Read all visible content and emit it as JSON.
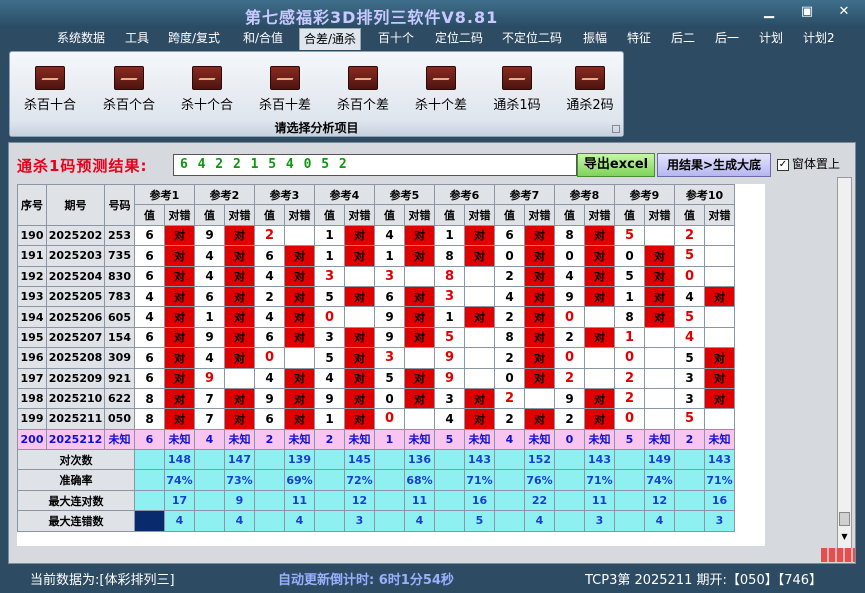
{
  "window": {
    "title": "第七感福彩3D排列三软件V8.81"
  },
  "menu": [
    "系统数据",
    "工具",
    "跨度/复式",
    "和/合值",
    "合差/通杀",
    "百十个",
    "定位二码",
    "不定位二码",
    "振幅",
    "特征",
    "后二",
    "后一",
    "计划",
    "计划2"
  ],
  "ribbon": {
    "buttons": [
      "杀百十合",
      "杀百个合",
      "杀十个合",
      "杀百十差",
      "杀百个差",
      "杀十个差",
      "通杀1码",
      "通杀2码"
    ],
    "caption": "请选择分析项目"
  },
  "prediction": {
    "label": "通杀1码预测结果:",
    "value": "6 4 2 2 1 5 4 0 5 2",
    "excel_button": "导出excel",
    "generate_button": "用结果>生成大底",
    "topmost_label": "窗体置上",
    "topmost_checked": true
  },
  "table": {
    "headers": {
      "seq": "序号",
      "period": "期号",
      "number": "号码",
      "refs": [
        "参考1",
        "参考2",
        "参考3",
        "参考4",
        "参考5",
        "参考6",
        "参考7",
        "参考8",
        "参考9",
        "参考10"
      ],
      "value": "值",
      "result": "对错"
    },
    "rows": [
      {
        "seq": "190",
        "period": "2025202",
        "number": "253",
        "cells": [
          [
            "6",
            "对"
          ],
          [
            "9",
            "对"
          ],
          [
            "2",
            ""
          ],
          [
            "1",
            "对"
          ],
          [
            "4",
            "对"
          ],
          [
            "1",
            "对"
          ],
          [
            "6",
            "对"
          ],
          [
            "8",
            "对"
          ],
          [
            "5",
            ""
          ],
          [
            "2",
            ""
          ]
        ]
      },
      {
        "seq": "191",
        "period": "2025203",
        "number": "735",
        "cells": [
          [
            "6",
            "对"
          ],
          [
            "4",
            "对"
          ],
          [
            "6",
            "对"
          ],
          [
            "1",
            "对"
          ],
          [
            "1",
            "对"
          ],
          [
            "8",
            "对"
          ],
          [
            "0",
            "对"
          ],
          [
            "0",
            "对"
          ],
          [
            "0",
            "对"
          ],
          [
            "5",
            ""
          ]
        ]
      },
      {
        "seq": "192",
        "period": "2025204",
        "number": "830",
        "cells": [
          [
            "6",
            "对"
          ],
          [
            "4",
            "对"
          ],
          [
            "4",
            "对"
          ],
          [
            "3",
            ""
          ],
          [
            "3",
            ""
          ],
          [
            "8",
            ""
          ],
          [
            "2",
            "对"
          ],
          [
            "4",
            "对"
          ],
          [
            "5",
            "对"
          ],
          [
            "0",
            ""
          ]
        ]
      },
      {
        "seq": "193",
        "period": "2025205",
        "number": "783",
        "cells": [
          [
            "4",
            "对"
          ],
          [
            "6",
            "对"
          ],
          [
            "2",
            "对"
          ],
          [
            "5",
            "对"
          ],
          [
            "6",
            "对"
          ],
          [
            "3",
            ""
          ],
          [
            "4",
            "对"
          ],
          [
            "9",
            "对"
          ],
          [
            "1",
            "对"
          ],
          [
            "4",
            "对"
          ]
        ]
      },
      {
        "seq": "194",
        "period": "2025206",
        "number": "605",
        "cells": [
          [
            "4",
            "对"
          ],
          [
            "1",
            "对"
          ],
          [
            "4",
            "对"
          ],
          [
            "0",
            ""
          ],
          [
            "9",
            "对"
          ],
          [
            "1",
            "对"
          ],
          [
            "2",
            "对"
          ],
          [
            "0",
            ""
          ],
          [
            "8",
            "对"
          ],
          [
            "5",
            ""
          ]
        ]
      },
      {
        "seq": "195",
        "period": "2025207",
        "number": "154",
        "cells": [
          [
            "6",
            "对"
          ],
          [
            "9",
            "对"
          ],
          [
            "6",
            "对"
          ],
          [
            "3",
            "对"
          ],
          [
            "9",
            "对"
          ],
          [
            "5",
            ""
          ],
          [
            "8",
            "对"
          ],
          [
            "2",
            "对"
          ],
          [
            "1",
            ""
          ],
          [
            "4",
            ""
          ]
        ]
      },
      {
        "seq": "196",
        "period": "2025208",
        "number": "309",
        "cells": [
          [
            "6",
            "对"
          ],
          [
            "4",
            "对"
          ],
          [
            "0",
            ""
          ],
          [
            "5",
            "对"
          ],
          [
            "3",
            ""
          ],
          [
            "9",
            ""
          ],
          [
            "2",
            "对"
          ],
          [
            "0",
            ""
          ],
          [
            "0",
            ""
          ],
          [
            "5",
            "对"
          ]
        ]
      },
      {
        "seq": "197",
        "period": "2025209",
        "number": "921",
        "cells": [
          [
            "6",
            "对"
          ],
          [
            "9",
            ""
          ],
          [
            "4",
            "对"
          ],
          [
            "4",
            "对"
          ],
          [
            "5",
            "对"
          ],
          [
            "9",
            ""
          ],
          [
            "0",
            "对"
          ],
          [
            "2",
            ""
          ],
          [
            "2",
            ""
          ],
          [
            "3",
            "对"
          ]
        ]
      },
      {
        "seq": "198",
        "period": "2025210",
        "number": "622",
        "cells": [
          [
            "8",
            "对"
          ],
          [
            "7",
            "对"
          ],
          [
            "9",
            "对"
          ],
          [
            "9",
            "对"
          ],
          [
            "0",
            "对"
          ],
          [
            "3",
            "对"
          ],
          [
            "2",
            ""
          ],
          [
            "9",
            "对"
          ],
          [
            "2",
            ""
          ],
          [
            "3",
            "对"
          ]
        ]
      },
      {
        "seq": "199",
        "period": "2025211",
        "number": "050",
        "cells": [
          [
            "8",
            "对"
          ],
          [
            "7",
            "对"
          ],
          [
            "6",
            "对"
          ],
          [
            "1",
            "对"
          ],
          [
            "0",
            ""
          ],
          [
            "4",
            "对"
          ],
          [
            "2",
            "对"
          ],
          [
            "2",
            "对"
          ],
          [
            "0",
            ""
          ],
          [
            "5",
            ""
          ]
        ]
      },
      {
        "seq": "200",
        "period": "2025212",
        "number": "未知",
        "cells": [
          [
            "6",
            "未知"
          ],
          [
            "4",
            "未知"
          ],
          [
            "2",
            "未知"
          ],
          [
            "2",
            "未知"
          ],
          [
            "1",
            "未知"
          ],
          [
            "5",
            "未知"
          ],
          [
            "4",
            "未知"
          ],
          [
            "0",
            "未知"
          ],
          [
            "5",
            "未知"
          ],
          [
            "2",
            "未知"
          ]
        ]
      }
    ],
    "stats": [
      {
        "label": "对次数",
        "values": [
          "148",
          "147",
          "139",
          "145",
          "136",
          "143",
          "152",
          "143",
          "149",
          "143"
        ]
      },
      {
        "label": "准确率",
        "values": [
          "74%",
          "73%",
          "69%",
          "72%",
          "68%",
          "71%",
          "76%",
          "71%",
          "74%",
          "71%"
        ]
      },
      {
        "label": "最大连对数",
        "values": [
          "17",
          "9",
          "11",
          "12",
          "11",
          "16",
          "22",
          "11",
          "12",
          "16"
        ]
      },
      {
        "label": "最大连错数",
        "values": [
          "4",
          "4",
          "4",
          "3",
          "4",
          "5",
          "4",
          "3",
          "4",
          "3"
        ]
      }
    ]
  },
  "status": {
    "data_source": "当前数据为:[体彩排列三]",
    "countdown": "自动更新倒计时: 6时1分54秒",
    "draw_info": "TCP3第 2025211 期开:【050】【746】"
  },
  "colors": {
    "hit": "#e00000",
    "unknown_row": "#f7c5ef",
    "stats_bg": "#8ef0f0",
    "stats_text": "#1a3fd0",
    "prediction_text": "#0a9a0a"
  }
}
